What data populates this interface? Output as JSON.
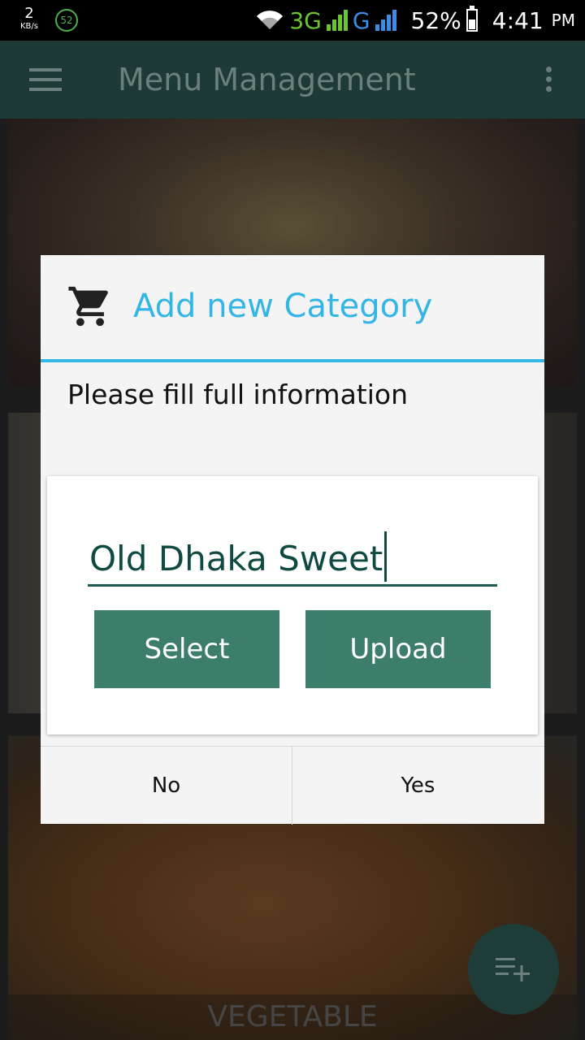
{
  "status_bar": {
    "speed_value": "2",
    "speed_unit": "KB/s",
    "notification_badge": "52",
    "network_type": "3G",
    "network_type_2": "G",
    "battery": "52%",
    "time": "4:41",
    "ampm": "PM",
    "colors": {
      "network_3g": "#6ac52e",
      "network_g": "#3a8ee6"
    }
  },
  "app_bar": {
    "title": "Menu Management",
    "menu_icon": "hamburger-menu-icon",
    "overflow_icon": "more-vert-icon"
  },
  "categories": [
    {
      "label": ""
    },
    {
      "label": ""
    },
    {
      "label": "VEGETABLE"
    }
  ],
  "dialog": {
    "icon": "cart-icon",
    "title": "Add new Category",
    "message": "Please fill full information",
    "input": {
      "value": "Old Dhaka Sweet"
    },
    "select_label": "Select",
    "upload_label": "Upload",
    "no_label": "No",
    "yes_label": "Yes",
    "accent_color": "#33b5e5",
    "button_color": "#3d7d6c"
  },
  "fab": {
    "icon": "playlist-add-icon"
  }
}
